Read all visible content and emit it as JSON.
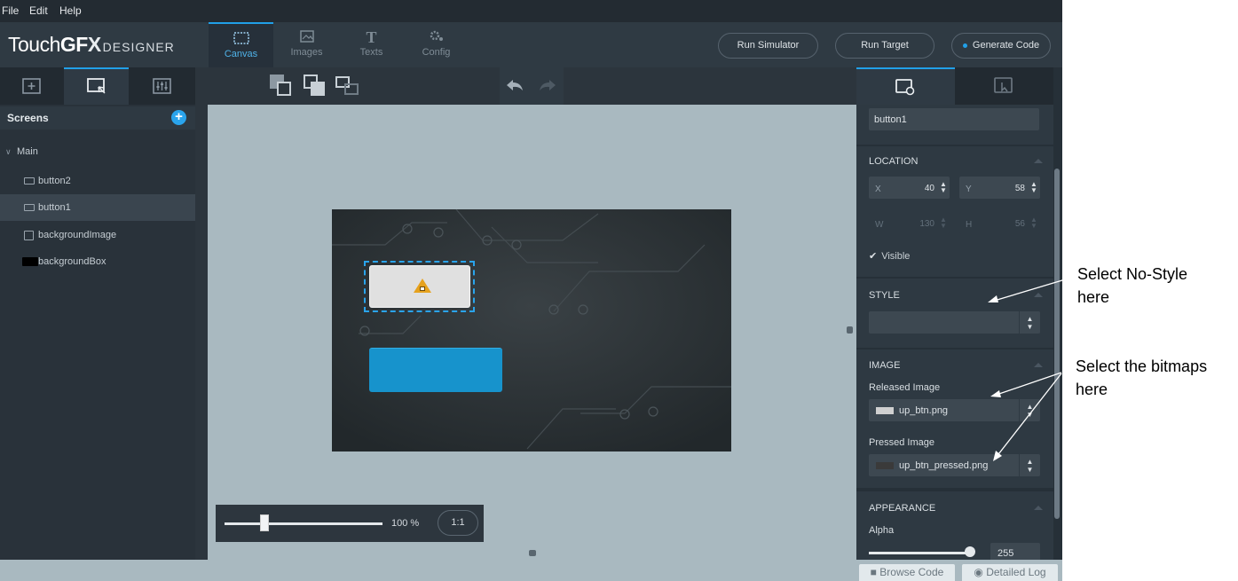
{
  "menu": {
    "file": "File",
    "edit": "Edit",
    "help": "Help"
  },
  "header": {
    "logo_brand_light": "Touch",
    "logo_brand_bold": "GF",
    "logo_brand_x": "X",
    "logo_sub": "DESIGNER",
    "tabs": [
      {
        "label": "Canvas",
        "icon": "canvas-icon",
        "active": true
      },
      {
        "label": "Images",
        "icon": "images-icon",
        "active": false
      },
      {
        "label": "Texts",
        "icon": "texts-icon",
        "active": false
      },
      {
        "label": "Config",
        "icon": "config-icon",
        "active": false
      }
    ],
    "run_simulator": "Run Simulator",
    "run_target": "Run Target",
    "generate_code": "Generate Code"
  },
  "left": {
    "tabs": [
      "add-widget-icon",
      "widget-tree-icon",
      "interactions-icon"
    ],
    "screens_label": "Screens",
    "tree": {
      "main": "Main",
      "items": [
        "button2",
        "button1",
        "backgroundImage",
        "backgroundBox"
      ]
    }
  },
  "canvas": {
    "zoom": "100 %",
    "zoom_reset": "1:1",
    "zoom_level": 0.25
  },
  "right": {
    "name_value": "button1",
    "location": {
      "title": "LOCATION",
      "x_label": "X",
      "x_value": "40",
      "y_label": "Y",
      "y_value": "58",
      "w_label": "W",
      "w_value": "130",
      "h_label": "H",
      "h_value": "56",
      "visible_label": "Visible"
    },
    "style": {
      "title": "STYLE",
      "value": ""
    },
    "image": {
      "title": "IMAGE",
      "released_label": "Released Image",
      "released_value": "up_btn.png",
      "pressed_label": "Pressed Image",
      "pressed_value": "up_btn_pressed.png"
    },
    "appearance": {
      "title": "APPEARANCE",
      "alpha_label": "Alpha",
      "alpha_value": "255"
    }
  },
  "status": {
    "browse_code": "Browse Code",
    "detailed_log": "Detailed Log"
  },
  "annotations": {
    "style_note_line1": "Select No-Style",
    "style_note_line2": "here",
    "bitmap_note_line1": "Select the bitmaps",
    "bitmap_note_line2": "here"
  },
  "colors": {
    "accent": "#21a0e8",
    "button_blue": "#1793cc",
    "canvas_bg": "#a9b9c0"
  }
}
